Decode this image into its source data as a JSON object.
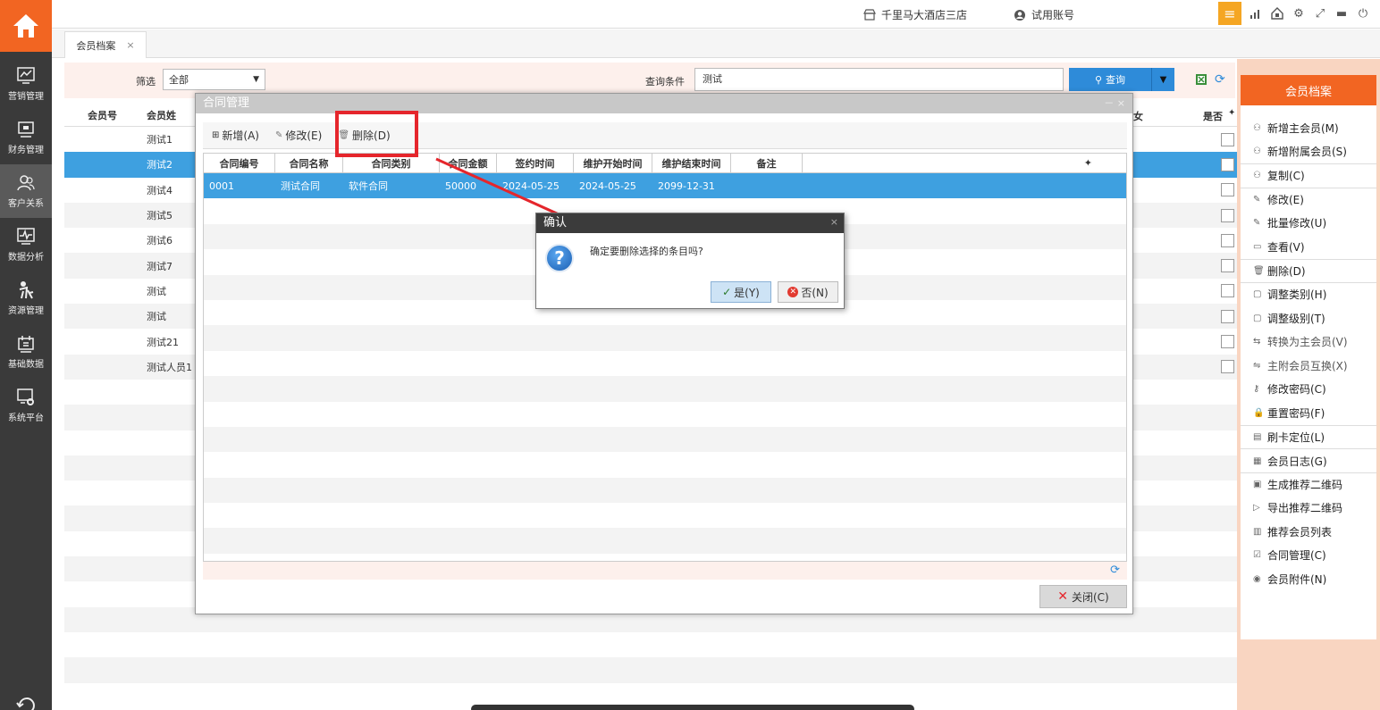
{
  "nav": {
    "items": [
      {
        "label": "营销管理",
        "icon": "chart-icon"
      },
      {
        "label": "财务管理",
        "icon": "monitor-icon"
      },
      {
        "label": "客户关系",
        "icon": "users-icon"
      },
      {
        "label": "数据分析",
        "icon": "pulse-icon"
      },
      {
        "label": "资源管理",
        "icon": "person-icon"
      },
      {
        "label": "基础数据",
        "icon": "calendar-icon"
      },
      {
        "label": "系统平台",
        "icon": "gear-monitor-icon"
      }
    ]
  },
  "topbar": {
    "hotel": "千里马大酒店三店",
    "account": "试用账号",
    "icons": [
      "menu-icon",
      "signal-icon",
      "home-lock-icon",
      "settings-icon",
      "expand-icon",
      "minimize-icon",
      "power-icon"
    ]
  },
  "tabs": [
    {
      "label": "会员档案",
      "close": "×"
    }
  ],
  "filter": {
    "filter_label": "筛选",
    "filter_value": "全部",
    "query_label": "查询条件",
    "query_value": "测试",
    "search_label": "查询"
  },
  "main_table": {
    "headers": {
      "id": "会员号",
      "name": "会员姓",
      "yes_no": "是否",
      "trunc_col": "女"
    },
    "rows": [
      {
        "name": "测试1"
      },
      {
        "name": "测试2"
      },
      {
        "name": "测试4"
      },
      {
        "name": "测试5"
      },
      {
        "name": "测试6"
      },
      {
        "name": "测试7"
      },
      {
        "name": "测试"
      },
      {
        "name": "测试"
      },
      {
        "name": "测试21"
      },
      {
        "name": "测试人员1"
      }
    ]
  },
  "right_panel": {
    "title": "会员档案",
    "items": [
      {
        "label": "新增主会员(M)",
        "icon": "person-icon"
      },
      {
        "label": "新增附属会员(S)",
        "icon": "person-icon"
      },
      {
        "label": "复制(C)",
        "icon": "person-icon"
      },
      {
        "label": "修改(E)",
        "icon": "edit-icon"
      },
      {
        "label": "批量修改(U)",
        "icon": "edit-icon"
      },
      {
        "label": "查看(V)",
        "icon": "view-icon"
      },
      {
        "label": "删除(D)",
        "icon": "trash-icon"
      },
      {
        "label": "调整类别(H)",
        "icon": "folder-icon"
      },
      {
        "label": "调整级别(T)",
        "icon": "folder-icon"
      },
      {
        "label": "转换为主会员(V)",
        "icon": "swap-icon"
      },
      {
        "label": "主附会员互换(X)",
        "icon": "swap-icon"
      },
      {
        "label": "修改密码(C)",
        "icon": "key-icon"
      },
      {
        "label": "重置密码(F)",
        "icon": "lock-icon"
      },
      {
        "label": "刷卡定位(L)",
        "icon": "card-icon"
      },
      {
        "label": "会员日志(G)",
        "icon": "log-icon"
      },
      {
        "label": "生成推荐二维码",
        "icon": "qr-icon"
      },
      {
        "label": "导出推荐二维码",
        "icon": "export-icon"
      },
      {
        "label": "推荐会员列表",
        "icon": "list-icon"
      },
      {
        "label": "合同管理(C)",
        "icon": "check-icon"
      },
      {
        "label": "会员附件(N)",
        "icon": "attach-icon"
      }
    ]
  },
  "contract_dialog": {
    "title": "合同管理",
    "title_controls": "－ ×",
    "toolbar": {
      "add": "新增(A)",
      "edit": "修改(E)",
      "delete": "删除(D)"
    },
    "headers": [
      "合同编号",
      "合同名称",
      "合同类别",
      "合同金额",
      "签约时间",
      "维护开始时间",
      "维护结束时间",
      "备注"
    ],
    "rows": [
      [
        "0001",
        "测试合同",
        "软件合同",
        "50000",
        "2024-05-25",
        "2024-05-25",
        "2099-12-31",
        ""
      ]
    ],
    "close_label": "关闭(C)"
  },
  "confirm_dialog": {
    "title": "确认",
    "close": "×",
    "message": "确定要删除选择的条目吗?",
    "yes": "是(Y)",
    "no": "否(N)"
  },
  "colors": {
    "accent": "#f26522",
    "selection": "#3ea0e0",
    "search_button": "#2e8bd9",
    "annotation_red": "#e5262c"
  }
}
